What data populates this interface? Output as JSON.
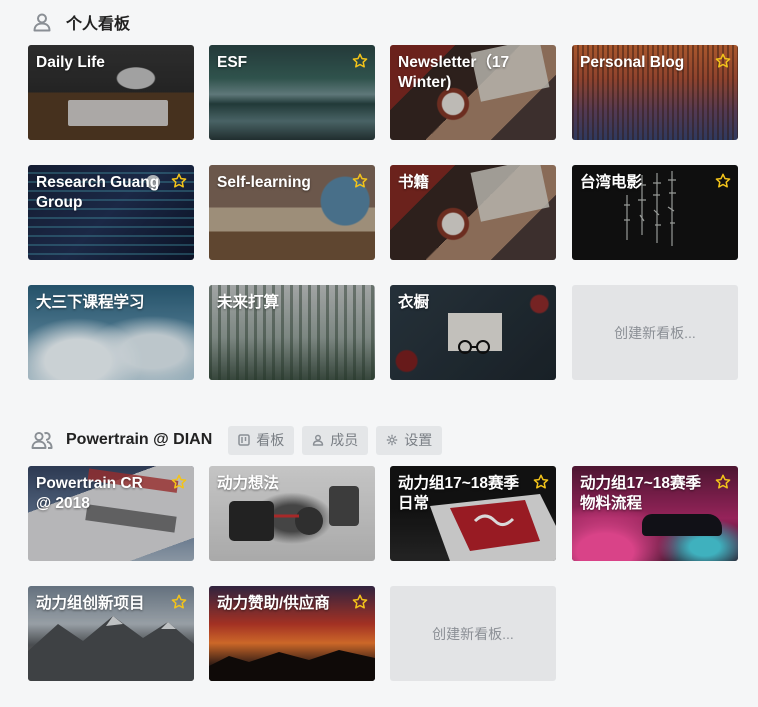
{
  "personal": {
    "title": "个人看板",
    "icon": "user-icon",
    "boards": [
      {
        "title": "Daily Life",
        "starred": false,
        "bg": "desk"
      },
      {
        "title": "ESF",
        "starred": true,
        "bg": "lake"
      },
      {
        "title": "Newsletter（17 Winter)",
        "starred": false,
        "bg": "cozy"
      },
      {
        "title": "Personal Blog",
        "starred": true,
        "bg": "sunset-reeds"
      },
      {
        "title": "Research Guang Group",
        "starred": true,
        "bg": "code"
      },
      {
        "title": "Self-learning",
        "starred": true,
        "bg": "books-globe"
      },
      {
        "title": "书籍",
        "starred": false,
        "bg": "cozy"
      },
      {
        "title": "台湾电影",
        "starred": true,
        "bg": "calligraphy"
      },
      {
        "title": "大三下课程学习",
        "starred": false,
        "bg": "clouds"
      },
      {
        "title": "未来打算",
        "starred": false,
        "bg": "foggy-forest"
      },
      {
        "title": "衣橱",
        "starred": false,
        "bg": "envelope"
      }
    ],
    "create_label": "创建新看板..."
  },
  "team": {
    "title": "Powertrain @ DIAN",
    "icon": "team-icon",
    "buttons": {
      "boards": "看板",
      "members": "成员",
      "settings": "设置"
    },
    "boards": [
      {
        "title": "Powertrain CR @ 2018",
        "starred": true,
        "bg": "flag"
      },
      {
        "title": "动力想法",
        "starred": false,
        "bg": "engine"
      },
      {
        "title": "动力组17~18赛季日常",
        "starred": true,
        "bg": "logo-red"
      },
      {
        "title": "动力组17~18赛季物料流程",
        "starred": true,
        "bg": "car-pink"
      },
      {
        "title": "动力组创新项目",
        "starred": true,
        "bg": "mountains"
      },
      {
        "title": "动力赞助/供应商",
        "starred": true,
        "bg": "red-sky"
      }
    ],
    "create_label": "创建新看板..."
  },
  "colors": {
    "star": "#f2c31a",
    "background": "#f5f6f7",
    "create_tile": "#e3e4e6"
  }
}
